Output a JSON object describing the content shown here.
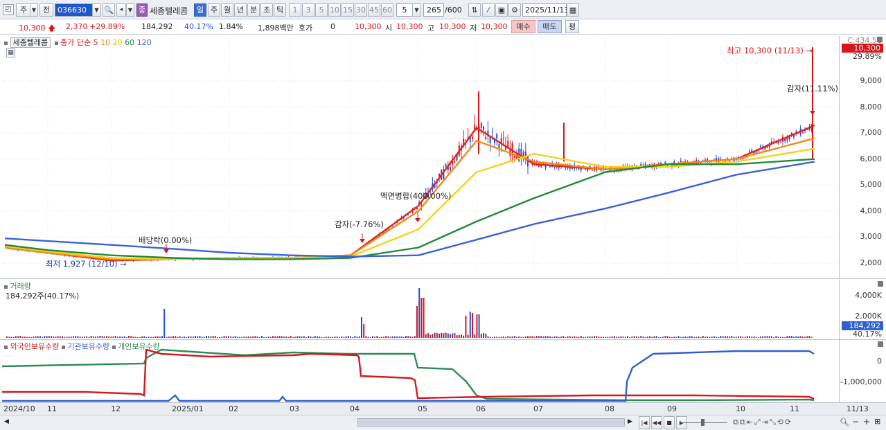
{
  "toolbar": {
    "market_label": "주",
    "prev_label": "전",
    "stock_code": "036630",
    "badge_label": "종",
    "stock_name": "세종텔레콤",
    "periods": [
      "일",
      "주",
      "월",
      "년",
      "분",
      "초",
      "틱"
    ],
    "intervals": [
      "1",
      "3",
      "5",
      "10",
      "15",
      "30",
      "45",
      "60"
    ],
    "interval_value": "5",
    "count_value": "265",
    "count_total": "/600",
    "date_value": "2025/11/13"
  },
  "quote": {
    "price": "10,300",
    "change": "2,370",
    "change_pct": "+29.89%",
    "volume": "184,292",
    "volume_ratio": "40.17%",
    "turnover_rate": "1.84%",
    "amount": "1,898백만",
    "hoga_label": "호가",
    "hoga_value": "0",
    "hoga_price": "10,300",
    "open_label": "시",
    "open": "10,300",
    "high_label": "고",
    "high": "10,300",
    "low_label": "저",
    "low": "10,300",
    "buy_label": "매수",
    "sell_label": "매도",
    "avg_label": "평"
  },
  "price_panel": {
    "title": "세종텔레콤",
    "ma_prefix": "종가 단순",
    "ma_periods": [
      {
        "label": "5",
        "color": "#e0241f"
      },
      {
        "label": "10",
        "color": "#f08a16"
      },
      {
        "label": "20",
        "color": "#f5d21a"
      },
      {
        "label": "60",
        "color": "#1f8a3a"
      },
      {
        "label": "120",
        "color": "#3a62d8"
      }
    ],
    "axis_top": "C:434.51",
    "current_price_badge": "10,300",
    "current_pct": "29.89%",
    "y_ticks": [
      "9,000",
      "8,000",
      "7,000",
      "6,000",
      "5,000",
      "4,000",
      "3,000",
      "2,000"
    ],
    "annotations": {
      "high": "최고 10,300 (11/13)",
      "low": "최저 1,927 (12/10)",
      "dividend": "배당락(0.00%)",
      "capital_reduction_1": "감자(-7.76%)",
      "reverse_split": "액면병합(400.00%)",
      "capital_reduction_2": "감자(11.11%)"
    }
  },
  "volume_panel": {
    "title": "거래량",
    "value_line": "184,292주(40.17%)",
    "y_ticks": [
      "4,000K",
      "2,000K"
    ],
    "current_badge": "184,292",
    "current_pct": "40.17%"
  },
  "holdings_panel": {
    "series": [
      {
        "label": "외국인보유수량",
        "color": "#d9151b"
      },
      {
        "label": "기관보유수량",
        "color": "#2f5fd0"
      },
      {
        "label": "개인보유수량",
        "color": "#2e8b57"
      }
    ],
    "y_ticks": [
      "0",
      "-1,000,000"
    ]
  },
  "x_axis": {
    "labels": [
      "2024/10",
      "11",
      "12",
      "2025/01",
      "02",
      "03",
      "04",
      "05",
      "06",
      "07",
      "08",
      "09",
      "10",
      "11"
    ],
    "last_date": "11/13"
  },
  "colors": {
    "up": "#d9151b",
    "down": "#1f4fd6",
    "ma5": "#e0241f",
    "ma10": "#f08a16",
    "ma20": "#f5d21a",
    "ma60": "#1f8a3a",
    "ma120": "#3a62d8"
  },
  "chart_data": [
    {
      "type": "line",
      "title": "세종텔레콤",
      "series": [
        {
          "name": "5",
          "x": [
            "2024/10",
            "11",
            "12",
            "2025/01",
            "02",
            "03",
            "04",
            "05",
            "06",
            "07",
            "08",
            "09",
            "10",
            "11/13"
          ],
          "values": [
            2600,
            2400,
            2100,
            2150,
            2200,
            2200,
            2300,
            4200,
            7200,
            5800,
            5600,
            5800,
            6000,
            7300
          ]
        },
        {
          "name": "10",
          "x": [
            "2024/10",
            "11",
            "12",
            "2025/01",
            "02",
            "03",
            "04",
            "05",
            "06",
            "07",
            "08",
            "09",
            "10",
            "11/13"
          ],
          "values": [
            2600,
            2400,
            2150,
            2150,
            2200,
            2200,
            2300,
            4000,
            6700,
            5900,
            5600,
            5800,
            6000,
            6800
          ]
        },
        {
          "name": "20",
          "x": [
            "2024/10",
            "11",
            "12",
            "2025/01",
            "02",
            "03",
            "04",
            "05",
            "06",
            "07",
            "08",
            "09",
            "10",
            "11/13"
          ],
          "values": [
            2650,
            2450,
            2200,
            2150,
            2200,
            2200,
            2250,
            3300,
            5500,
            6200,
            5700,
            5700,
            5900,
            6400
          ]
        },
        {
          "name": "60",
          "x": [
            "2024/10",
            "11",
            "12",
            "2025/01",
            "02",
            "03",
            "04",
            "05",
            "06",
            "07",
            "08",
            "09",
            "10",
            "11/13"
          ],
          "values": [
            2700,
            2500,
            2300,
            2200,
            2150,
            2150,
            2200,
            2600,
            3600,
            4500,
            5500,
            5800,
            5800,
            6000
          ]
        },
        {
          "name": "120",
          "x": [
            "2024/10",
            "11",
            "12",
            "2025/01",
            "02",
            "03",
            "04",
            "05",
            "06",
            "07",
            "08",
            "09",
            "10",
            "11/13"
          ],
          "values": [
            2950,
            2850,
            2700,
            2550,
            2400,
            2300,
            2250,
            2300,
            2900,
            3500,
            4100,
            4700,
            5400,
            5900
          ]
        }
      ],
      "ylim": [
        1500,
        10300
      ]
    }
  ]
}
